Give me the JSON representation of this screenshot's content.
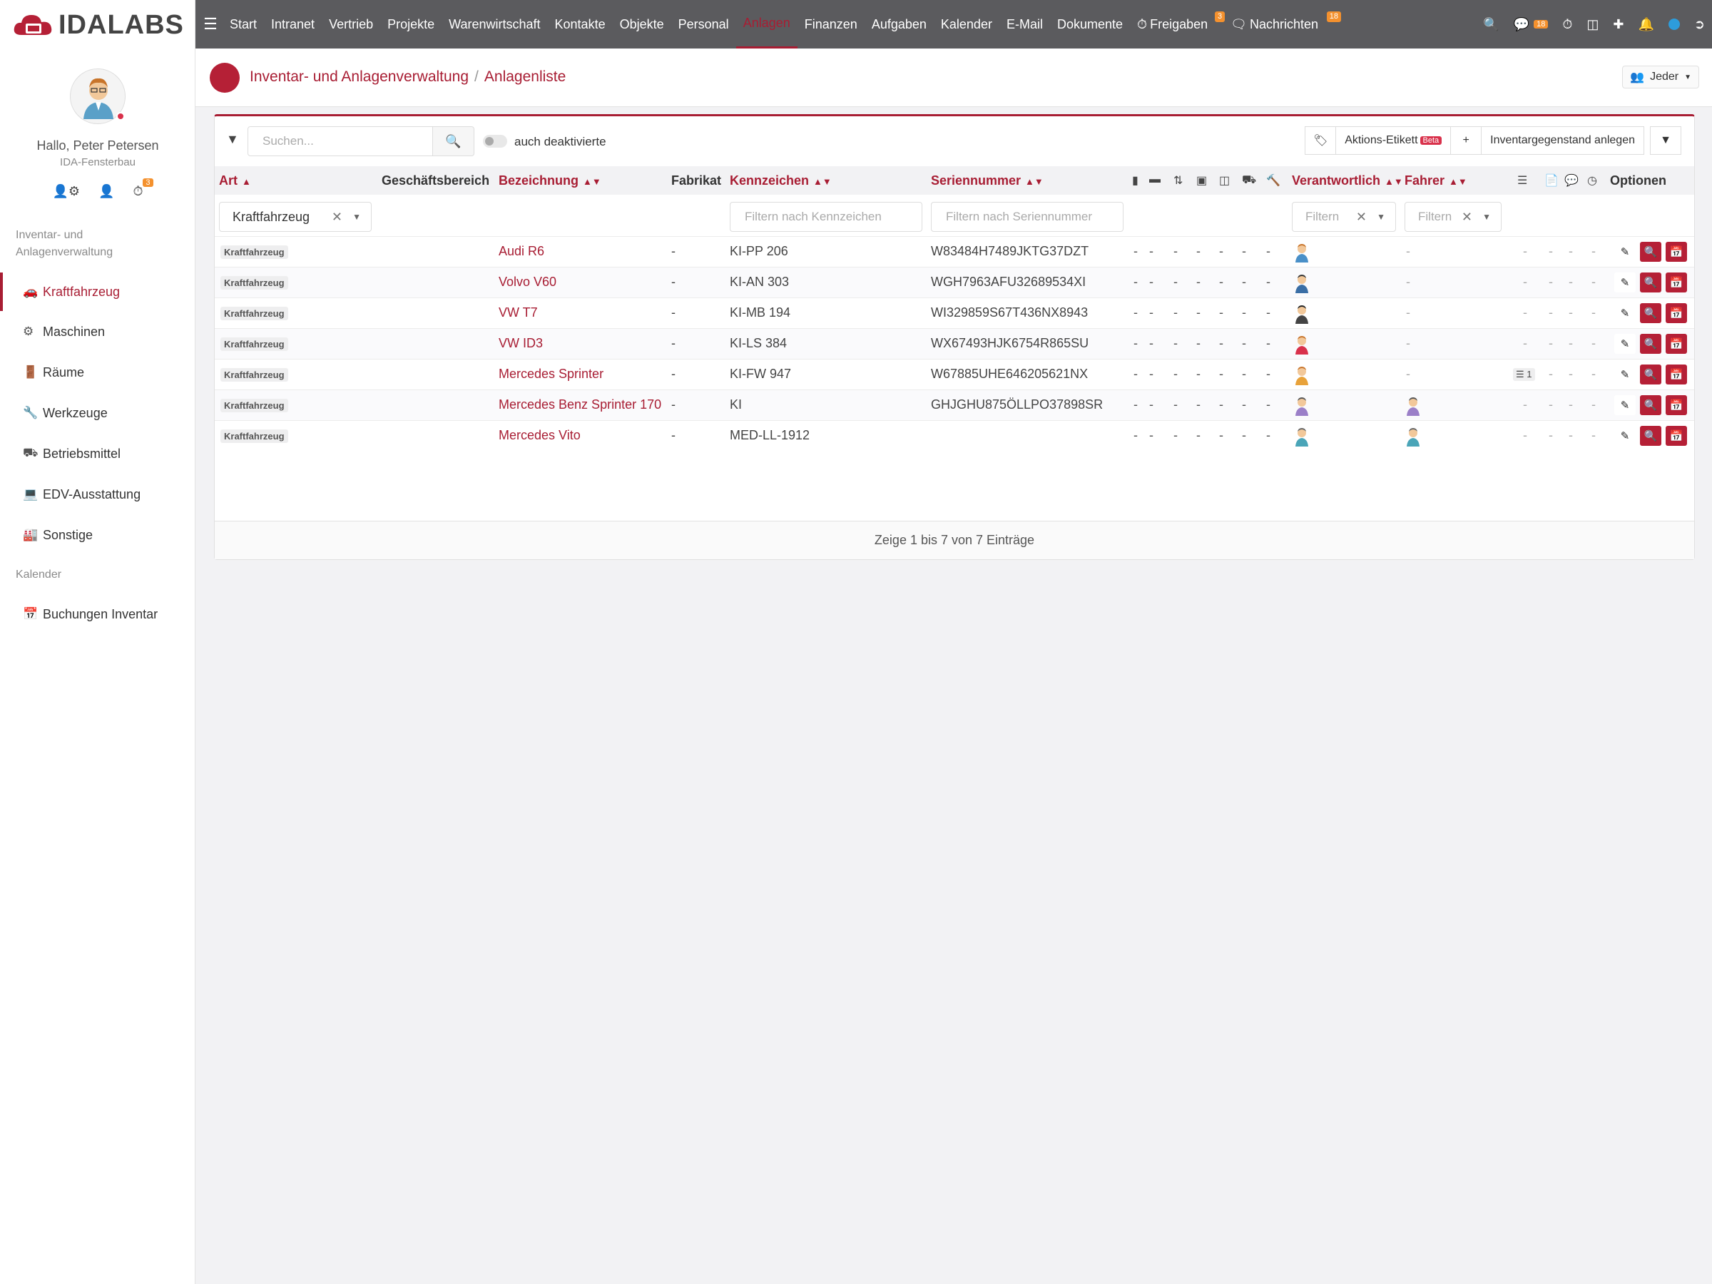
{
  "app": {
    "logo_text": "IDALABS"
  },
  "user": {
    "greeting": "Hallo, Peter Petersen",
    "company": "IDA-Fensterbau",
    "badge": "3"
  },
  "sidebar": {
    "section1": "Inventar- und Anlagenverwaltung",
    "items": [
      {
        "label": "Kraftfahrzeug",
        "icon": "car-icon"
      },
      {
        "label": "Maschinen",
        "icon": "gears-icon"
      },
      {
        "label": "Räume",
        "icon": "door-icon"
      },
      {
        "label": "Werkzeuge",
        "icon": "wrench-icon"
      },
      {
        "label": "Betriebsmittel",
        "icon": "forklift-icon"
      },
      {
        "label": "EDV-Ausstattung",
        "icon": "computer-icon"
      },
      {
        "label": "Sonstige",
        "icon": "industry-icon"
      }
    ],
    "section2": "Kalender",
    "calendar_item": "Buchungen Inventar"
  },
  "nav": {
    "items": [
      "Start",
      "Intranet",
      "Vertrieb",
      "Projekte",
      "Warenwirtschaft",
      "Kontakte",
      "Objekte",
      "Personal",
      "Anlagen",
      "Finanzen",
      "Aufgaben",
      "Kalender",
      "E-Mail",
      "Dokumente"
    ],
    "freigaben": "Freigaben",
    "freigaben_badge": "3",
    "nachrichten": "Nachrichten",
    "nachrichten_badge": "18",
    "chat_badge": "18"
  },
  "header": {
    "crumb1": "Inventar- und Anlagenverwaltung",
    "crumb2": "Anlagenliste",
    "owner_filter": "Jeder"
  },
  "toolbar": {
    "search_placeholder": "Suchen...",
    "toggle_label": "auch deaktivierte",
    "action_label": "Aktions-Etikett",
    "beta": "Beta",
    "create_label": "Inventargegenstand anlegen"
  },
  "table": {
    "headers": {
      "art": "Art",
      "bereich": "Geschäftsbereich",
      "bezeichnung": "Bezeichnung",
      "fabrikat": "Fabrikat",
      "kennzeichen": "Kennzeichen",
      "seriennummer": "Seriennummer",
      "verantwortlich": "Verantwortlich",
      "fahrer": "Fahrer",
      "optionen": "Optionen"
    },
    "filters": {
      "art": "Kraftfahrzeug",
      "kennzeichen_placeholder": "Filtern nach Kennzeichen",
      "serien_placeholder": "Filtern nach Seriennummer",
      "verantwortlich_placeholder": "Filtern",
      "fahrer_placeholder": "Filtern"
    },
    "rows": [
      {
        "art": "Kraftfahrzeug",
        "name": "Audi R6",
        "fabrikat": "-",
        "kennzeichen": "KI-PP 206",
        "serie": "W83484H7489JKTG37DZT",
        "fahrer": "-",
        "checklist": ""
      },
      {
        "art": "Kraftfahrzeug",
        "name": "Volvo V60",
        "fabrikat": "-",
        "kennzeichen": "KI-AN 303",
        "serie": "WGH7963AFU32689534XI",
        "fahrer": "-",
        "checklist": ""
      },
      {
        "art": "Kraftfahrzeug",
        "name": "VW T7",
        "fabrikat": "-",
        "kennzeichen": "KI-MB 194",
        "serie": "WI329859S67T436NX8943",
        "fahrer": "-",
        "checklist": ""
      },
      {
        "art": "Kraftfahrzeug",
        "name": "VW ID3",
        "fabrikat": "-",
        "kennzeichen": "KI-LS 384",
        "serie": "WX67493HJK6754R865SU",
        "fahrer": "-",
        "checklist": ""
      },
      {
        "art": "Kraftfahrzeug",
        "name": "Mercedes Sprinter",
        "fabrikat": "-",
        "kennzeichen": "KI-FW 947",
        "serie": "W67885UHE646205621NX",
        "fahrer": "-",
        "checklist": "1"
      },
      {
        "art": "Kraftfahrzeug",
        "name": "Mercedes Benz Sprinter 170",
        "fabrikat": "-",
        "kennzeichen": "KI",
        "serie": "GHJGHU875ÖLLPO37898SR",
        "fahrer": "",
        "checklist": ""
      },
      {
        "art": "Kraftfahrzeug",
        "name": "Mercedes Vito",
        "fabrikat": "-",
        "kennzeichen": "MED-LL-1912",
        "serie": "",
        "fahrer": "",
        "checklist": ""
      }
    ],
    "dash": "-",
    "footer": "Zeige 1 bis 7 von 7 Einträge"
  },
  "colors": {
    "accent": "#a81d33",
    "nav_bg": "#5b5b5e",
    "badge": "#f4912e"
  }
}
